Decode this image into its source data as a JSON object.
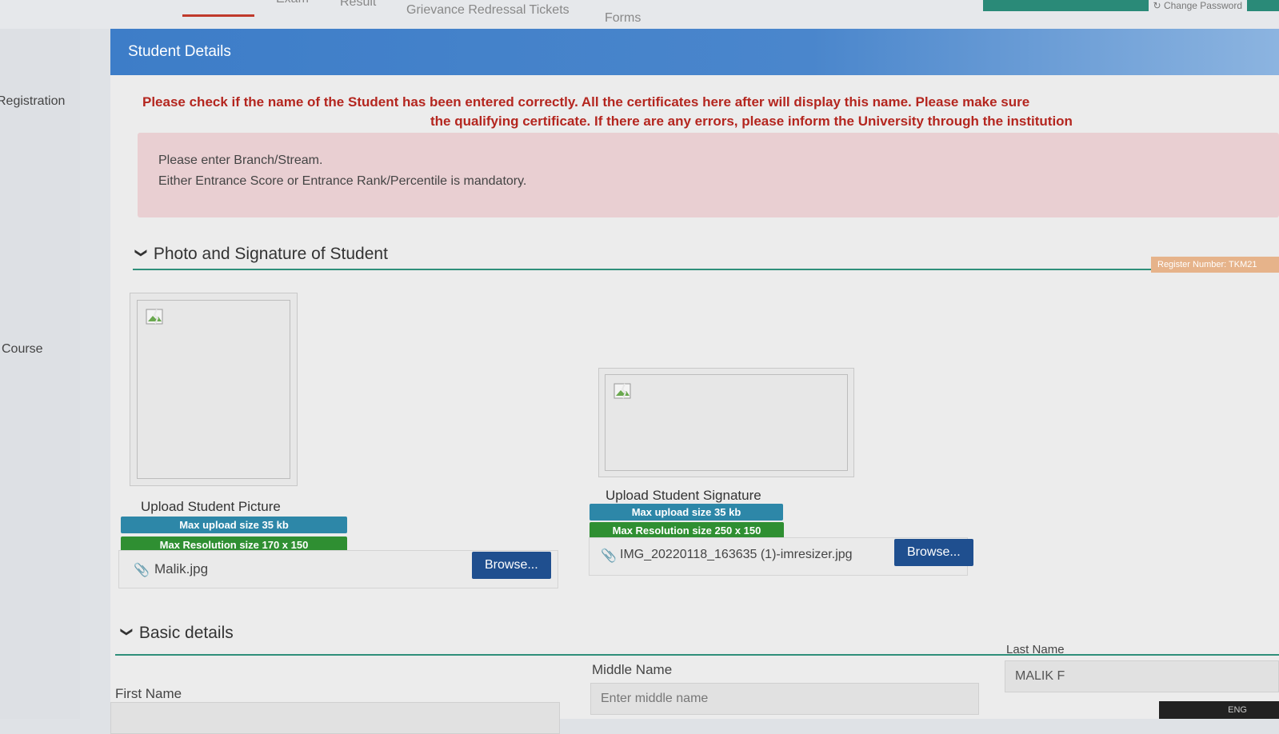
{
  "nav": {
    "tabs": [
      {
        "label": "Exam"
      },
      {
        "label": "Result"
      },
      {
        "label": "Grievance Redressal Tickets"
      },
      {
        "label": "Forms"
      }
    ],
    "change_password": "Change Password"
  },
  "sidebar": {
    "items": [
      {
        "label": "Registration"
      },
      {
        "label": "Course"
      }
    ]
  },
  "panel": {
    "title": "Student Details",
    "warning_line1": "Please check if the name of the Student has been entered correctly. All the certificates here after will display this name. Please make sure",
    "warning_line2": "the qualifying certificate. If there are any errors, please inform the University through the institution",
    "alert": {
      "line1": "Please enter Branch/Stream.",
      "line2": "Either Entrance Score or Entrance Rank/Percentile is mandatory."
    },
    "register_number": "Register Number: TKM21"
  },
  "photo_section": {
    "title": "Photo and Signature of Student",
    "picture": {
      "label": "Upload Student Picture",
      "badge_size": "Max upload size 35 kb",
      "badge_resolution": "Max Resolution size 170 x 150",
      "file_name": "Malik.jpg",
      "browse_label": "Browse..."
    },
    "signature": {
      "label": "Upload Student Signature",
      "badge_size": "Max upload size 35 kb",
      "badge_resolution": "Max Resolution size 250 x 150",
      "file_name": "IMG_20220118_163635 (1)-imresizer.jpg",
      "browse_label": "Browse..."
    }
  },
  "basic_section": {
    "title": "Basic details",
    "first_name_label": "First Name",
    "first_name_value": "",
    "middle_name_label": "Middle Name",
    "middle_name_placeholder": "Enter middle name",
    "last_name_label": "Last Name",
    "last_name_value": "MALIK F"
  },
  "taskbar": {
    "lang": "ENG"
  },
  "colors": {
    "header_blue": "#3d7dc8",
    "section_line": "#2f8f7a",
    "badge_blue": "#2d87a8",
    "badge_green": "#2f8f32",
    "browse_button": "#1f4f8f",
    "warning_red": "#b4261f"
  },
  "icons": {
    "section_toggle": "chevron-down-icon",
    "file": "paperclip-icon",
    "broken_image": "broken-image-icon"
  }
}
